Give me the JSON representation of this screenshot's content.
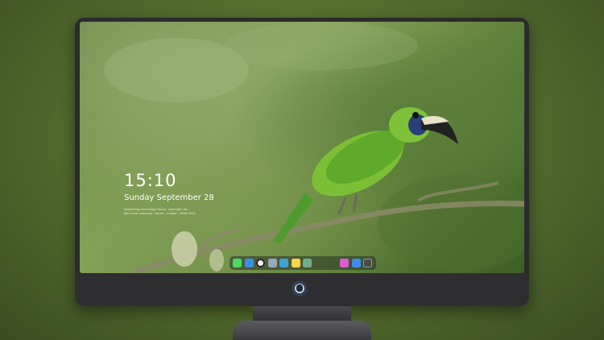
{
  "lock_screen": {
    "time": "15:10",
    "date": "Sunday September 28",
    "notice_line1": "interesting technology forum, copyright, No",
    "notice_line2": "your hour company - forum - unique - 2006-2023"
  },
  "dock": {
    "apps": [
      {
        "icon": "messages-icon",
        "color": "#4cd964"
      },
      {
        "icon": "finder-icon",
        "color": "#3a8ee6"
      },
      {
        "icon": "clock-icon",
        "color": "#f2f2f2"
      },
      {
        "icon": "preview-icon",
        "color": "#9aa7b8"
      },
      {
        "icon": "clapper-icon",
        "color": "#3aa3d8"
      },
      {
        "icon": "notes-icon",
        "color": "#f5d54a"
      },
      {
        "icon": "photos-icon",
        "color": "#6fae8c"
      },
      {
        "icon": "itunes-icon",
        "color": "#e05bd0"
      },
      {
        "icon": "app-store-icon",
        "color": "#3d8df0"
      },
      {
        "icon": "terminal-icon",
        "color": "#4a4a4a"
      }
    ]
  },
  "colors": {
    "background": "#56702f",
    "monitor_bezel": "#2b2b2e"
  }
}
